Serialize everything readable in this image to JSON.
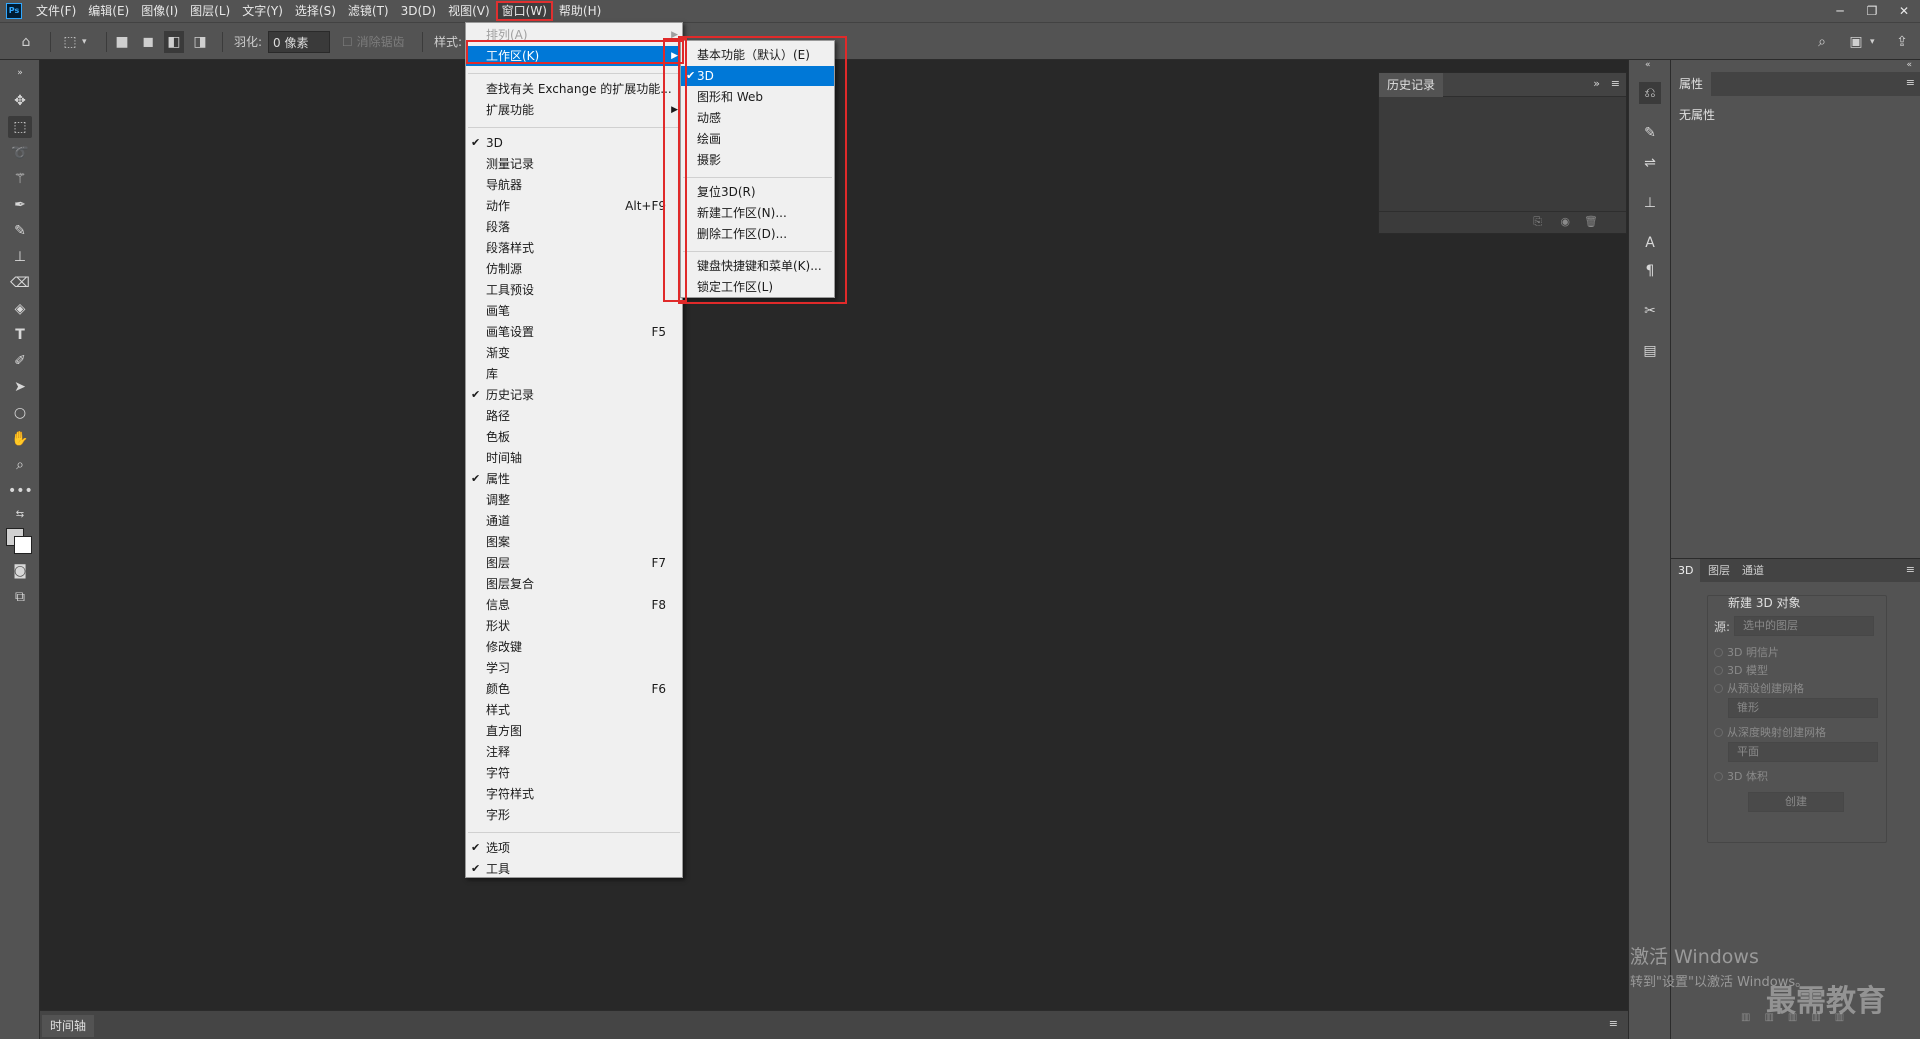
{
  "menubar": {
    "logo": "Ps",
    "items": [
      "文件(F)",
      "编辑(E)",
      "图像(I)",
      "图层(L)",
      "文字(Y)",
      "选择(S)",
      "滤镜(T)",
      "3D(D)",
      "视图(V)",
      "窗口(W)",
      "帮助(H)"
    ],
    "active_index": 9
  },
  "options": {
    "feather_label": "羽化:",
    "feather_value": "0 像素",
    "antialias_label": "消除锯齿",
    "style_label": "样式:"
  },
  "history_panel": {
    "title": "历史记录"
  },
  "properties_panel": {
    "title": "属性",
    "empty_text": "无属性"
  },
  "threed_panel": {
    "tabs": [
      "3D",
      "图层",
      "通道"
    ],
    "new_object_title": "新建 3D 对象",
    "source_label": "源:",
    "source_value": "选中的图层",
    "options": [
      "3D 明信片",
      "3D 模型",
      "从预设创建网格"
    ],
    "preset_value": "锥形",
    "depth_option": "从深度映射创建网格",
    "depth_value": "平面",
    "volume_option": "3D 体积",
    "create_button": "创建"
  },
  "timeline": {
    "label": "时间轴"
  },
  "watermark": {
    "line1": "激活 Windows",
    "line2": "转到\"设置\"以激活 Windows。",
    "brand": "最需教育"
  },
  "window_menu": {
    "items": [
      {
        "label": "排列(A)",
        "disabled": true,
        "submenu": true
      },
      {
        "label": "工作区(K)",
        "highlight": true,
        "submenu": true
      },
      {
        "sep": true
      },
      {
        "label": "查找有关 Exchange 的扩展功能..."
      },
      {
        "label": "扩展功能",
        "submenu": true
      },
      {
        "sep": true
      },
      {
        "label": "3D",
        "checked": true
      },
      {
        "label": "测量记录"
      },
      {
        "label": "导航器"
      },
      {
        "label": "动作",
        "shortcut": "Alt+F9"
      },
      {
        "label": "段落"
      },
      {
        "label": "段落样式"
      },
      {
        "label": "仿制源"
      },
      {
        "label": "工具预设"
      },
      {
        "label": "画笔"
      },
      {
        "label": "画笔设置",
        "shortcut": "F5"
      },
      {
        "label": "渐变"
      },
      {
        "label": "库"
      },
      {
        "label": "历史记录",
        "checked": true
      },
      {
        "label": "路径"
      },
      {
        "label": "色板"
      },
      {
        "label": "时间轴"
      },
      {
        "label": "属性",
        "checked": true
      },
      {
        "label": "调整"
      },
      {
        "label": "通道"
      },
      {
        "label": "图案"
      },
      {
        "label": "图层",
        "shortcut": "F7"
      },
      {
        "label": "图层复合"
      },
      {
        "label": "信息",
        "shortcut": "F8"
      },
      {
        "label": "形状"
      },
      {
        "label": "修改键"
      },
      {
        "label": "学习"
      },
      {
        "label": "颜色",
        "shortcut": "F6"
      },
      {
        "label": "样式"
      },
      {
        "label": "直方图"
      },
      {
        "label": "注释"
      },
      {
        "label": "字符"
      },
      {
        "label": "字符样式"
      },
      {
        "label": "字形"
      },
      {
        "sep": true
      },
      {
        "label": "选项",
        "checked": true
      },
      {
        "label": "工具",
        "checked": true
      }
    ]
  },
  "workspace_submenu": {
    "items": [
      {
        "label": "基本功能（默认）(E)"
      },
      {
        "label": "3D",
        "checked": true,
        "highlight": true
      },
      {
        "label": "图形和 Web"
      },
      {
        "label": "动感"
      },
      {
        "label": "绘画"
      },
      {
        "label": "摄影"
      },
      {
        "sep": true
      },
      {
        "label": "复位3D(R)"
      },
      {
        "label": "新建工作区(N)..."
      },
      {
        "label": "删除工作区(D)..."
      },
      {
        "sep": true
      },
      {
        "label": "键盘快捷键和菜单(K)..."
      },
      {
        "label": "锁定工作区(L)"
      }
    ]
  }
}
